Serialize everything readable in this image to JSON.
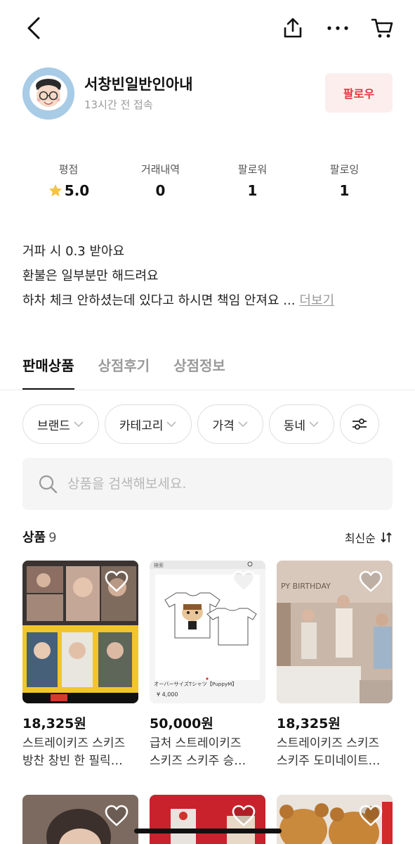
{
  "topbar": {
    "back_icon": "chevron-left-icon",
    "share_icon": "share-icon",
    "more_icon": "more-horizontal-icon",
    "cart_icon": "cart-icon"
  },
  "profile": {
    "nickname": "서창빈일반인아내",
    "last_seen": "13시간 전 접속",
    "follow_label": "팔로우",
    "accent": "#e8343f"
  },
  "stats": [
    {
      "label": "평점",
      "value": "5.0",
      "icon": "star-icon"
    },
    {
      "label": "거래내역",
      "value": "0"
    },
    {
      "label": "팔로워",
      "value": "1"
    },
    {
      "label": "팔로잉",
      "value": "1"
    }
  ],
  "bio": {
    "line1": "거파 시 0.3 받아요",
    "line2": "환불은 일부분만 해드려요",
    "line3": "하차 체크 안하셨는데 있다고 하시면 책임 안져요 ...",
    "more": "더보기"
  },
  "tabs": [
    {
      "label": "판매상품",
      "active": true
    },
    {
      "label": "상점후기",
      "active": false
    },
    {
      "label": "상점정보",
      "active": false
    }
  ],
  "filters": [
    "브랜드",
    "카테고리",
    "가격",
    "동네"
  ],
  "search": {
    "placeholder": "상품을 검색해보세요."
  },
  "products_header": {
    "title": "상품",
    "count": "9",
    "sort": "최신순"
  },
  "products": [
    {
      "price": "18,325원",
      "name_line1": "스트레이키즈 스키즈",
      "name_line2": "방찬 창빈 한 필릭…"
    },
    {
      "price": "50,000원",
      "name_line1": "급처 스트레이키즈",
      "name_line2": "스키즈 스키주 승…",
      "thumb_caption": "オーバーサイズTシャツ【PuppyM】",
      "thumb_price": "¥ 4,000",
      "thumb_search": "検索"
    },
    {
      "price": "18,325원",
      "name_line1": "스트레이키즈 스키즈",
      "name_line2": "스키주 도미네이트…",
      "thumb_banner": "PY BIRTHDAY"
    }
  ]
}
